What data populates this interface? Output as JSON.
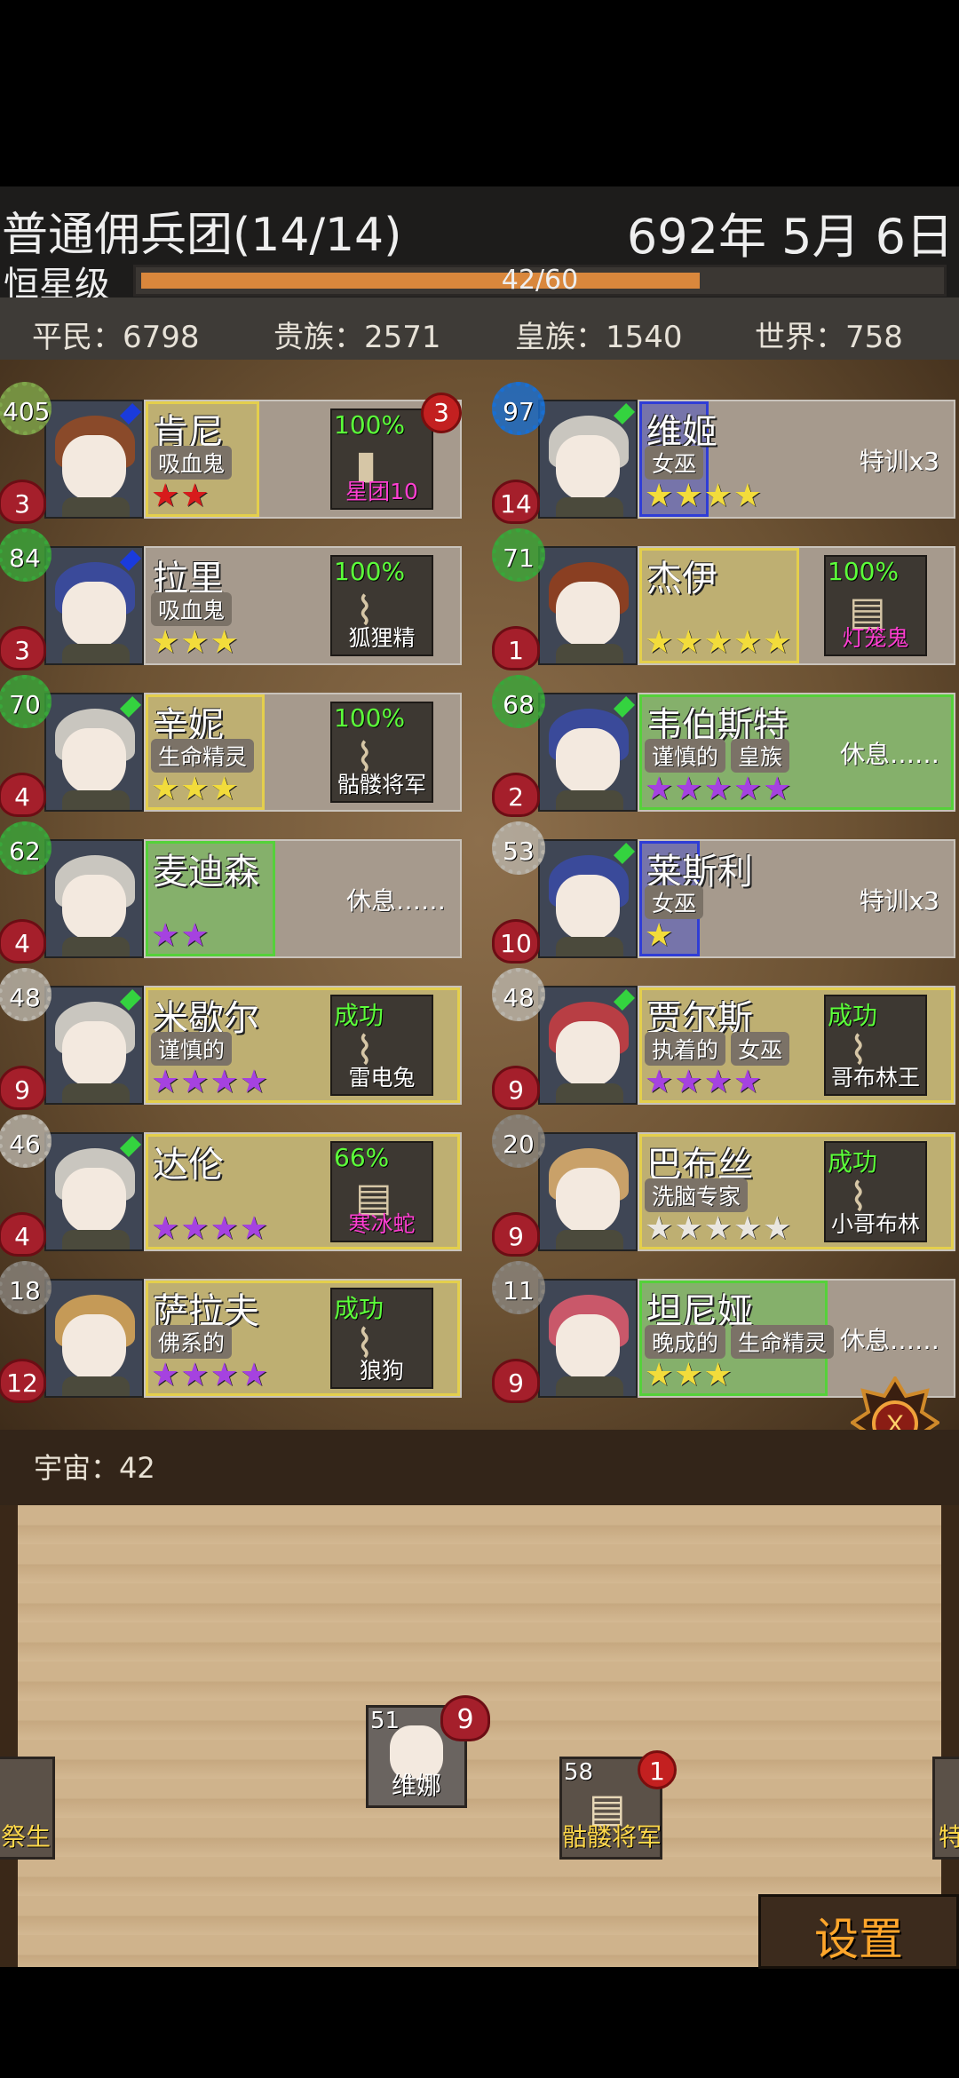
{
  "header": {
    "guild_name": "普通佣兵团(14/14)",
    "date": "692年 5月 6日",
    "rank": "恒星级",
    "xp_text": "42/60",
    "xp_fraction": 0.7
  },
  "stats": {
    "commoners": "平民：6798",
    "nobles": "贵族：2571",
    "royals": "皇族：1540",
    "world": "世界：758"
  },
  "units": [
    {
      "level": "405",
      "level_color": "#7fa64a",
      "hearts": "3",
      "gem": "#1a3bdc",
      "hair": "#8a4a2a",
      "name": "肯尼",
      "tags": [
        "吸血鬼"
      ],
      "stars": "★★",
      "star_color": "#d81b1b",
      "highlight": "#e4cf4c",
      "hl_width": 128,
      "task": {
        "top": "100%",
        "name": "星团10",
        "badge": "3",
        "glyph": "▮"
      },
      "status": ""
    },
    {
      "level": "97",
      "level_color": "#1a6fd1",
      "hearts": "14",
      "gem": "#34d33f",
      "hair": "#c9c6bf",
      "name": "维姬",
      "tags": [
        "女巫"
      ],
      "stars": "★★★★",
      "star_color": "#f2dc3b",
      "highlight": "#2f3dd6",
      "hl_width": 78,
      "task": null,
      "status": "特训x3"
    },
    {
      "level": "84",
      "level_color": "#39a63a",
      "hearts": "3",
      "gem": "#1a3bdc",
      "hair": "#3a4a9a",
      "name": "拉里",
      "tags": [
        "吸血鬼"
      ],
      "stars": "★★★",
      "star_color": "#f2dc3b",
      "highlight": "",
      "hl_width": 0,
      "task": {
        "top": "100%",
        "name": "狐狸精",
        "badge": "",
        "glyph": "⌇"
      },
      "status": ""
    },
    {
      "level": "71",
      "level_color": "#39a63a",
      "hearts": "1",
      "gem": "",
      "hair": "#8a3f22",
      "name": "杰伊",
      "tags": [],
      "stars": "★★★★★",
      "star_color": "#f2dc3b",
      "highlight": "#e4cf4c",
      "hl_width": 180,
      "task": {
        "top": "100%",
        "name": "灯笼鬼",
        "badge": "",
        "glyph": "▤"
      },
      "status": ""
    },
    {
      "level": "70",
      "level_color": "#39a63a",
      "hearts": "4",
      "gem": "#34d33f",
      "hair": "#c9c6bf",
      "name": "辛妮",
      "tags": [
        "生命精灵"
      ],
      "stars": "★★★",
      "star_color": "#f2dc3b",
      "highlight": "#e4cf4c",
      "hl_width": 134,
      "task": {
        "top": "100%",
        "name": "骷髅将军",
        "badge": "",
        "glyph": "⌇"
      },
      "status": ""
    },
    {
      "level": "68",
      "level_color": "#39a63a",
      "hearts": "2",
      "gem": "#34d33f",
      "hair": "#3a4a9a",
      "name": "韦伯斯特",
      "tags": [
        "谨慎的",
        "皇族"
      ],
      "stars": "★★★★★",
      "star_color": "#a542e0",
      "highlight": "#55d13a",
      "hl_width": 354,
      "task": null,
      "status": "休息……"
    },
    {
      "level": "62",
      "level_color": "#39a63a",
      "hearts": "4",
      "gem": "",
      "hair": "#c9c6bf",
      "name": "麦迪森",
      "tags": [],
      "stars": "★★",
      "star_color": "#a542e0",
      "highlight": "#55d13a",
      "hl_width": 146,
      "task": null,
      "status": "休息……"
    },
    {
      "level": "53",
      "level_color": "#b9b4aa",
      "hearts": "10",
      "gem": "#34d33f",
      "hair": "#3a4a9a",
      "name": "莱斯利",
      "tags": [
        "女巫"
      ],
      "stars": "★",
      "star_color": "#f2dc3b",
      "highlight": "#2f3dd6",
      "hl_width": 68,
      "task": null,
      "status": "特训x3"
    },
    {
      "level": "48",
      "level_color": "#b9b4aa",
      "hearts": "9",
      "gem": "#34d33f",
      "hair": "#c9c6bf",
      "name": "米歇尔",
      "tags": [
        "谨慎的"
      ],
      "stars": "★★★★",
      "star_color": "#a542e0",
      "highlight": "#e4cf4c",
      "hl_width": 354,
      "task": {
        "top": "成功",
        "name": "雷电兔",
        "badge": "",
        "glyph": "⌇"
      },
      "status": ""
    },
    {
      "level": "48",
      "level_color": "#b9b4aa",
      "hearts": "9",
      "gem": "#34d33f",
      "hair": "#b83e44",
      "name": "贾尔斯",
      "tags": [
        "执着的",
        "女巫"
      ],
      "stars": "★★★★",
      "star_color": "#a542e0",
      "highlight": "#e4cf4c",
      "hl_width": 354,
      "task": {
        "top": "成功",
        "name": "哥布林王",
        "badge": "",
        "glyph": "⌇"
      },
      "status": ""
    },
    {
      "level": "46",
      "level_color": "#b9b4aa",
      "hearts": "4",
      "gem": "#34d33f",
      "hair": "#c9c6bf",
      "name": "达伦",
      "tags": [],
      "stars": "★★★★",
      "star_color": "#a542e0",
      "highlight": "#e4cf4c",
      "hl_width": 354,
      "task": {
        "top": "66%",
        "name": "寒冰蛇",
        "badge": "",
        "glyph": "▤"
      },
      "status": ""
    },
    {
      "level": "20",
      "level_color": "#8a857d",
      "hearts": "9",
      "gem": "",
      "hair": "#c9a169",
      "name": "巴布丝",
      "tags": [
        "洗脑专家"
      ],
      "stars": "★★★★★",
      "star_color": "#e9e6e0",
      "highlight": "#e4cf4c",
      "hl_width": 354,
      "task": {
        "top": "成功",
        "name": "小哥布林",
        "badge": "",
        "glyph": "⌇"
      },
      "status": ""
    },
    {
      "level": "18",
      "level_color": "#8a857d",
      "hearts": "12",
      "gem": "",
      "hair": "#c59a57",
      "name": "萨拉夫",
      "tags": [
        "佛系的"
      ],
      "stars": "★★★★",
      "star_color": "#a542e0",
      "highlight": "#e4cf4c",
      "hl_width": 354,
      "task": {
        "top": "成功",
        "name": "狼狗",
        "badge": "",
        "glyph": "⌇"
      },
      "status": ""
    },
    {
      "level": "11",
      "level_color": "#8a857d",
      "hearts": "9",
      "gem": "",
      "hair": "#c9586a",
      "name": "坦尼娅",
      "tags": [
        "晚成的",
        "生命精灵"
      ],
      "stars": "★★★",
      "star_color": "#f2dc3b",
      "highlight": "#55d13a",
      "hl_width": 212,
      "task": null,
      "status": "休息……"
    }
  ],
  "universe": "宇宙：42",
  "tray": {
    "left_label": "祭生",
    "unit_level": "51",
    "unit_hearts": "9",
    "unit_name": "维娜",
    "item_count": "58",
    "item_badge": "1",
    "item_name": "骷髅将军",
    "right_label": "特"
  },
  "settings_label": "设置",
  "emblem_icon": "x-emblem-icon"
}
